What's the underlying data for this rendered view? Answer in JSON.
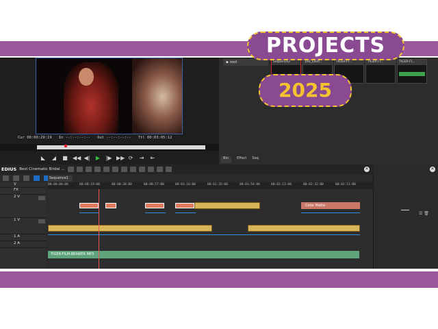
{
  "overlay": {
    "title": "PROJECTS",
    "year": "2025",
    "colors": {
      "bar": "#9b5a9c",
      "pill": "#8a4a91",
      "pill_border": "#f4c430",
      "year_text": "#f4c430"
    }
  },
  "player": {
    "cur_label": "Cur",
    "cur_value": "00:00:29:19",
    "in_label": "In",
    "in_value": "--:--:--:--",
    "out_label": "Out",
    "out_value": "--:--:--:--",
    "ttl_label": "Ttl",
    "ttl_value": "00:03:05:12"
  },
  "bin": {
    "root_label": "root",
    "items": [
      {
        "label": "Sequence2"
      },
      {
        "label": "100_Elem..."
      },
      {
        "label": "TIGER-FI..."
      },
      {
        "label": "TIGER-FI..."
      },
      {
        "label": "TIGER-FI..."
      }
    ],
    "tabs": [
      "Bin",
      "Effect",
      "Seq"
    ]
  },
  "timeline": {
    "brand": "EDIUS",
    "project_name": "Best Cinematic Bridal ...",
    "sequence_tab": "Sequence1",
    "ruler_ticks": [
      "00:00:00:00",
      "00:00:19:00",
      "00:00:38:00",
      "00:00:57:00",
      "00:01:16:00",
      "00:01:35:00",
      "00:01:54:00",
      "00:02:13:00",
      "00:02:32:00",
      "00:02:51:00"
    ],
    "track_labels": [
      "V",
      "FX",
      "2 V",
      "1 V",
      "1 A",
      "2 A"
    ],
    "matte_label": "Color Matte",
    "audio_clip": "TIGER-FILM-BEAWER MP3"
  }
}
